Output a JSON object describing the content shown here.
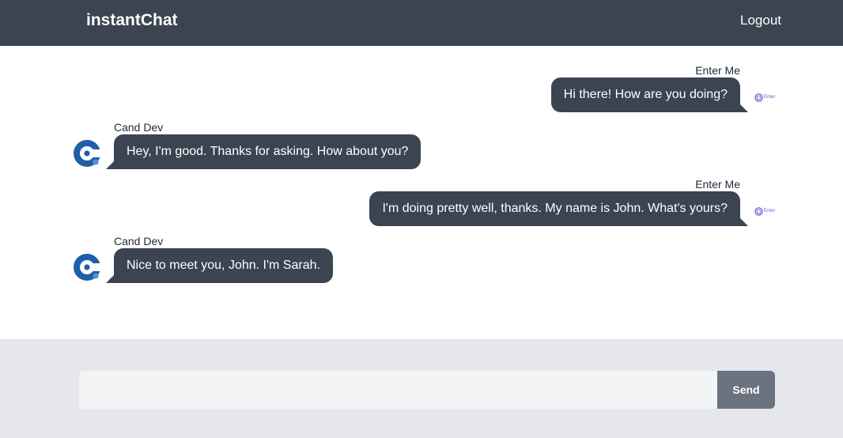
{
  "header": {
    "brand": "instantChat",
    "logout_label": "Logout",
    "background": "#3c4452"
  },
  "messages": [
    {
      "sender": "Enter Me",
      "text": "Hi there! How are you doing?",
      "mine": true,
      "avatar_text": "Enter"
    },
    {
      "sender": "Cand Dev",
      "text": "Hey, I'm good. Thanks for asking. How about you?",
      "mine": false
    },
    {
      "sender": "Enter Me",
      "text": "I'm doing pretty well, thanks. My name is John. What's yours?",
      "mine": true,
      "avatar_text": "Enter"
    },
    {
      "sender": "Cand Dev",
      "text": "Nice to meet you, John. I'm Sarah.",
      "mine": false
    }
  ],
  "composer": {
    "input_value": "",
    "placeholder": "",
    "send_label": "Send"
  },
  "colors": {
    "bubble": "#3c4452",
    "footer": "#e5e7eb",
    "send_button": "#6b7280",
    "avatar_blue": "#1e5fa8",
    "enter_logo": "#6d5dd3"
  },
  "icons": {
    "their_avatar": "c-logo-avatar",
    "my_avatar": "enter-logo-avatar"
  }
}
